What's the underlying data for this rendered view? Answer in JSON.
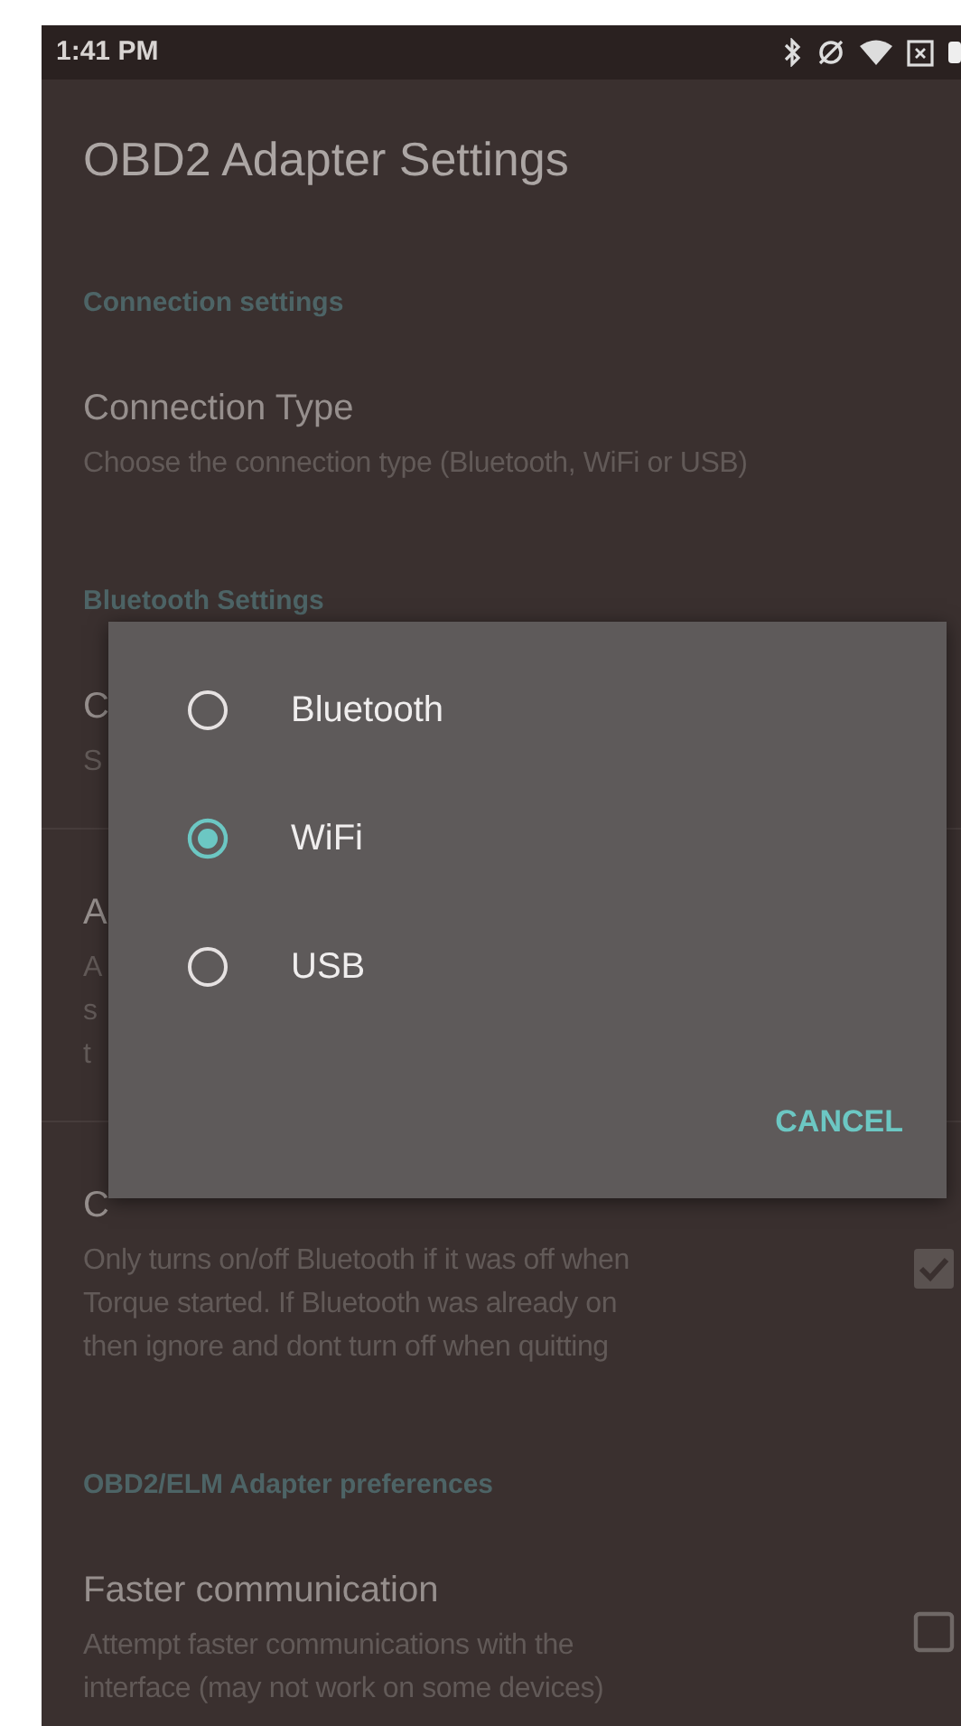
{
  "status_bar": {
    "time": "1:41 PM"
  },
  "app_bar": {
    "title": "OBD2 Adapter Settings"
  },
  "sections": [
    {
      "header": "Connection settings",
      "items": [
        {
          "title": "Connection Type",
          "summary_lines": [
            "Choose the connection type (Bluetooth, WiFi or USB)"
          ]
        }
      ]
    },
    {
      "header": "Bluetooth Settings",
      "items": [
        {
          "title": "C",
          "summary_lines": [
            "S"
          ]
        },
        {
          "title": "A",
          "summary_lines": [
            "A",
            "s",
            "t"
          ]
        },
        {
          "title": "C",
          "summary_lines": [
            "Only turns on/off Bluetooth if it was off when",
            "Torque started. If Bluetooth was already on",
            "then ignore and dont turn off when quitting"
          ],
          "checked": true
        }
      ]
    },
    {
      "header": "OBD2/ELM Adapter preferences",
      "items": [
        {
          "title": "Faster communication",
          "summary_lines": [
            "Attempt faster communications with the",
            "interface (may not work on some devices)"
          ],
          "checked": false
        }
      ]
    }
  ],
  "dialog": {
    "options": [
      {
        "label": "Bluetooth",
        "selected": false
      },
      {
        "label": "WiFi",
        "selected": true
      },
      {
        "label": "USB",
        "selected": false
      }
    ],
    "button": "CANCEL"
  }
}
